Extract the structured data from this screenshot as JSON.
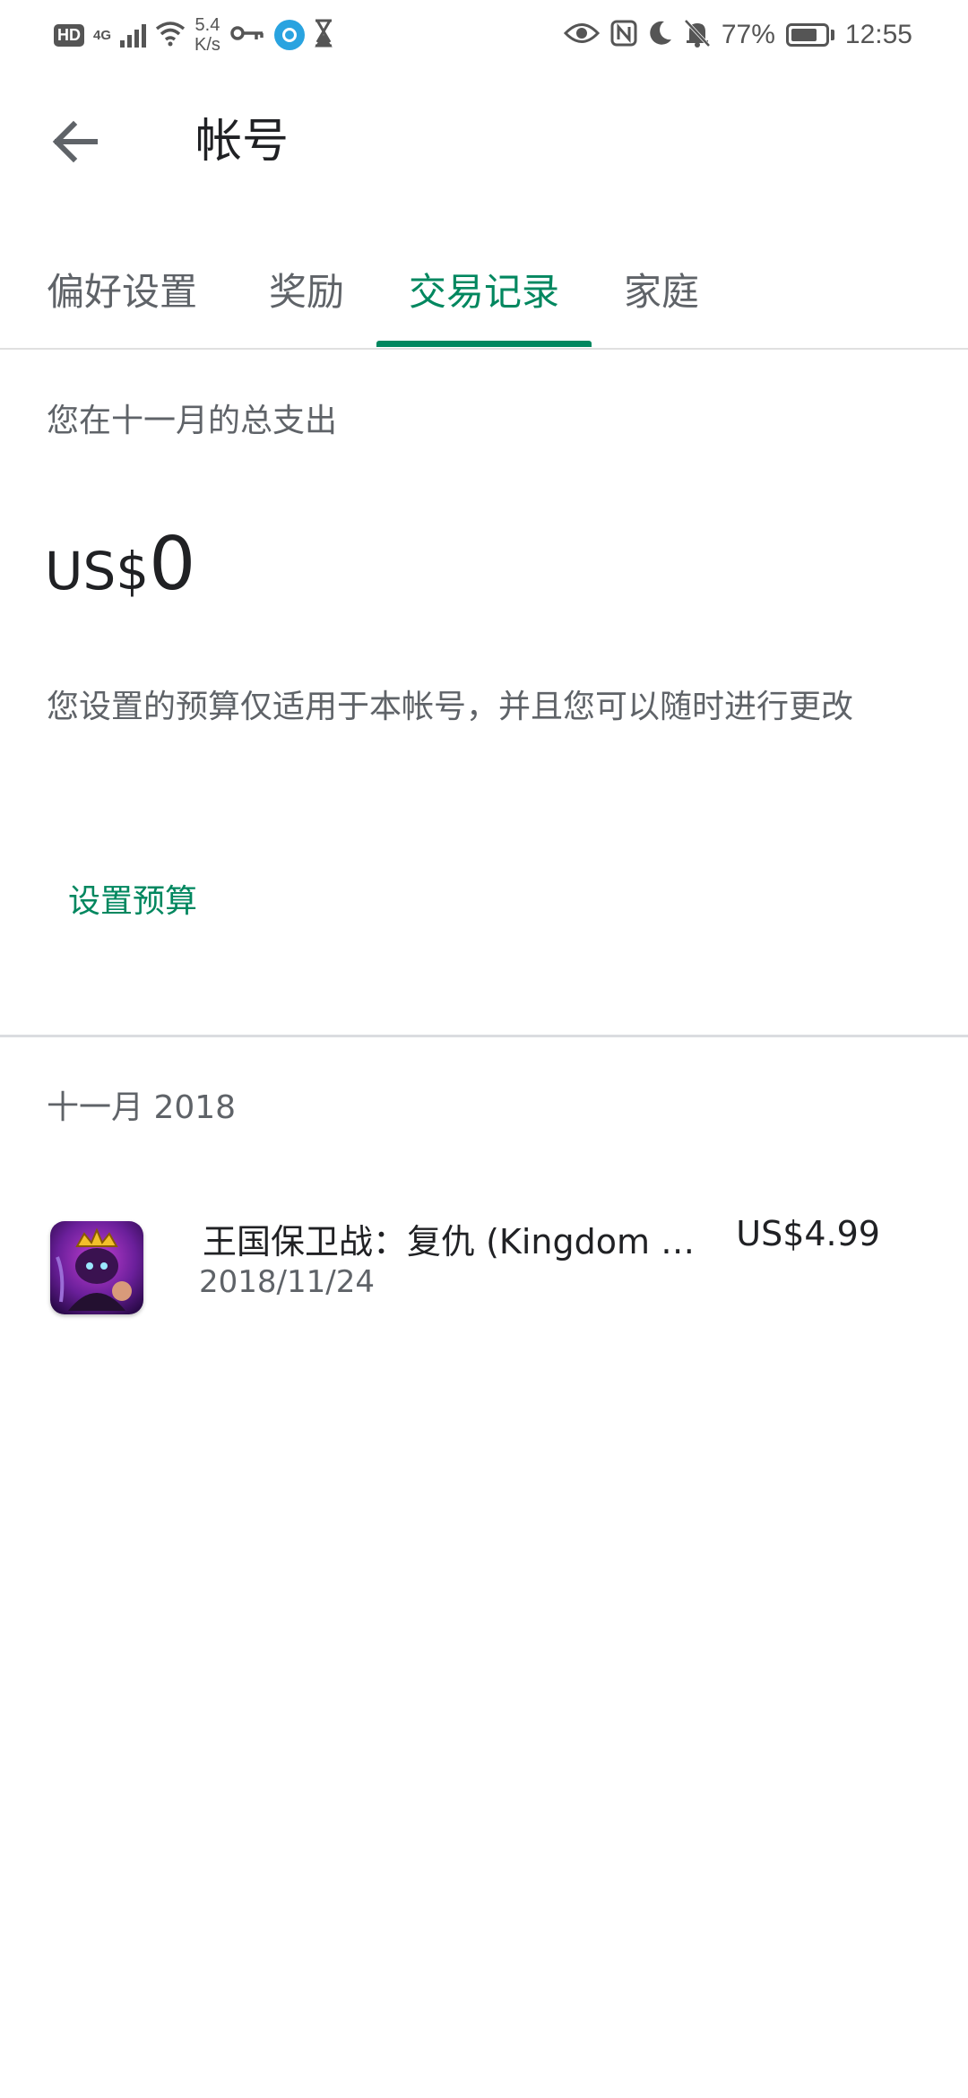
{
  "status_bar": {
    "hd_badge": "HD",
    "network": "4G",
    "speed_value": "5.4",
    "speed_unit": "K/s",
    "battery_percent": "77%",
    "battery_level": 0.77,
    "time": "12:55",
    "icons": [
      "hd-icon",
      "signal-icon",
      "wifi-icon",
      "key-icon",
      "app-notification-icon",
      "hourglass-icon",
      "eye-icon",
      "nfc-icon",
      "moon-icon",
      "bell-muted-icon",
      "battery-icon"
    ]
  },
  "app_bar": {
    "title": "帐号",
    "back_icon": "arrow-back-icon"
  },
  "tabs": [
    {
      "label": "偏好设置",
      "active": false
    },
    {
      "label": "奖励",
      "active": false
    },
    {
      "label": "交易记录",
      "active": true
    },
    {
      "label": "家庭",
      "active": false
    }
  ],
  "summary": {
    "label": "您在十一月的总支出",
    "currency": "US$",
    "amount": "0",
    "budget_note": "您设置的预算仅适用于本帐号，并且您可以随时进行更改",
    "set_budget_label": "设置预算"
  },
  "history": {
    "month_label": "十一月 2018",
    "transactions": [
      {
        "title": "王国保卫战：复仇 (Kingdom Rush Vengeance)",
        "price": "US$4.99",
        "date": "2018/11/24",
        "icon": "game-app-icon"
      }
    ]
  },
  "colors": {
    "accent": "#01875f",
    "text_primary": "#202124",
    "text_secondary": "#5f6368",
    "divider": "#dadce0"
  }
}
